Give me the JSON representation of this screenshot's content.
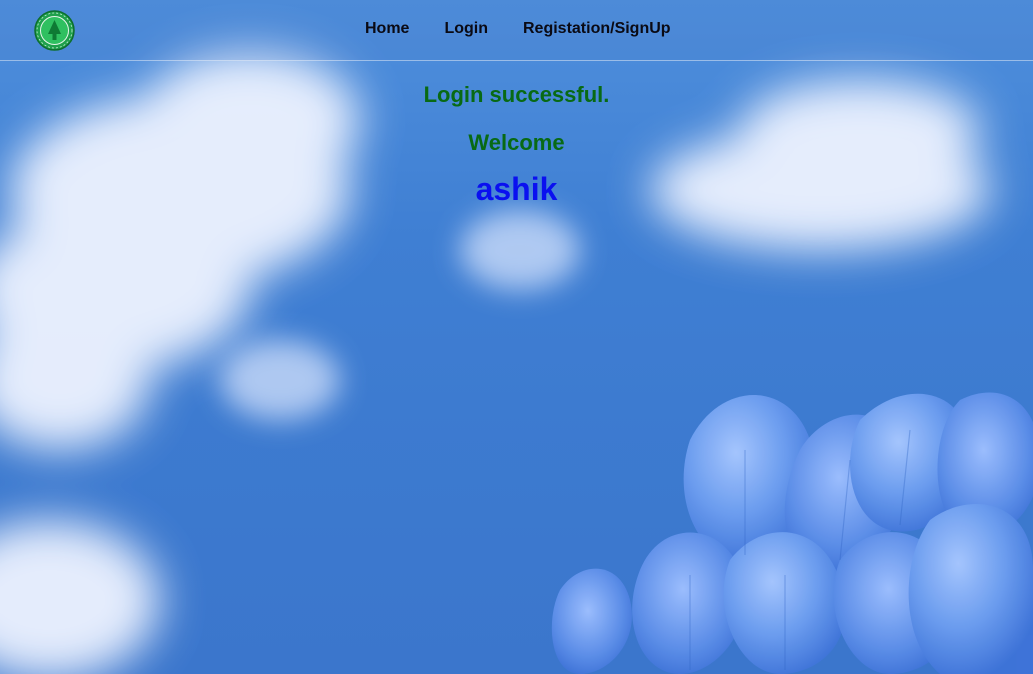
{
  "nav": {
    "home_label": "Home",
    "login_label": "Login",
    "register_label": "Registation/SignUp"
  },
  "main": {
    "status_message": "Login successful.",
    "welcome_label": "Welcome",
    "username": "ashik"
  },
  "colors": {
    "status_text": "#086a14",
    "username_text": "#0a10f0",
    "nav_text": "#0a0a14",
    "sky": "#3f7fd3"
  },
  "icons": {
    "logo": "university-seal-logo"
  }
}
